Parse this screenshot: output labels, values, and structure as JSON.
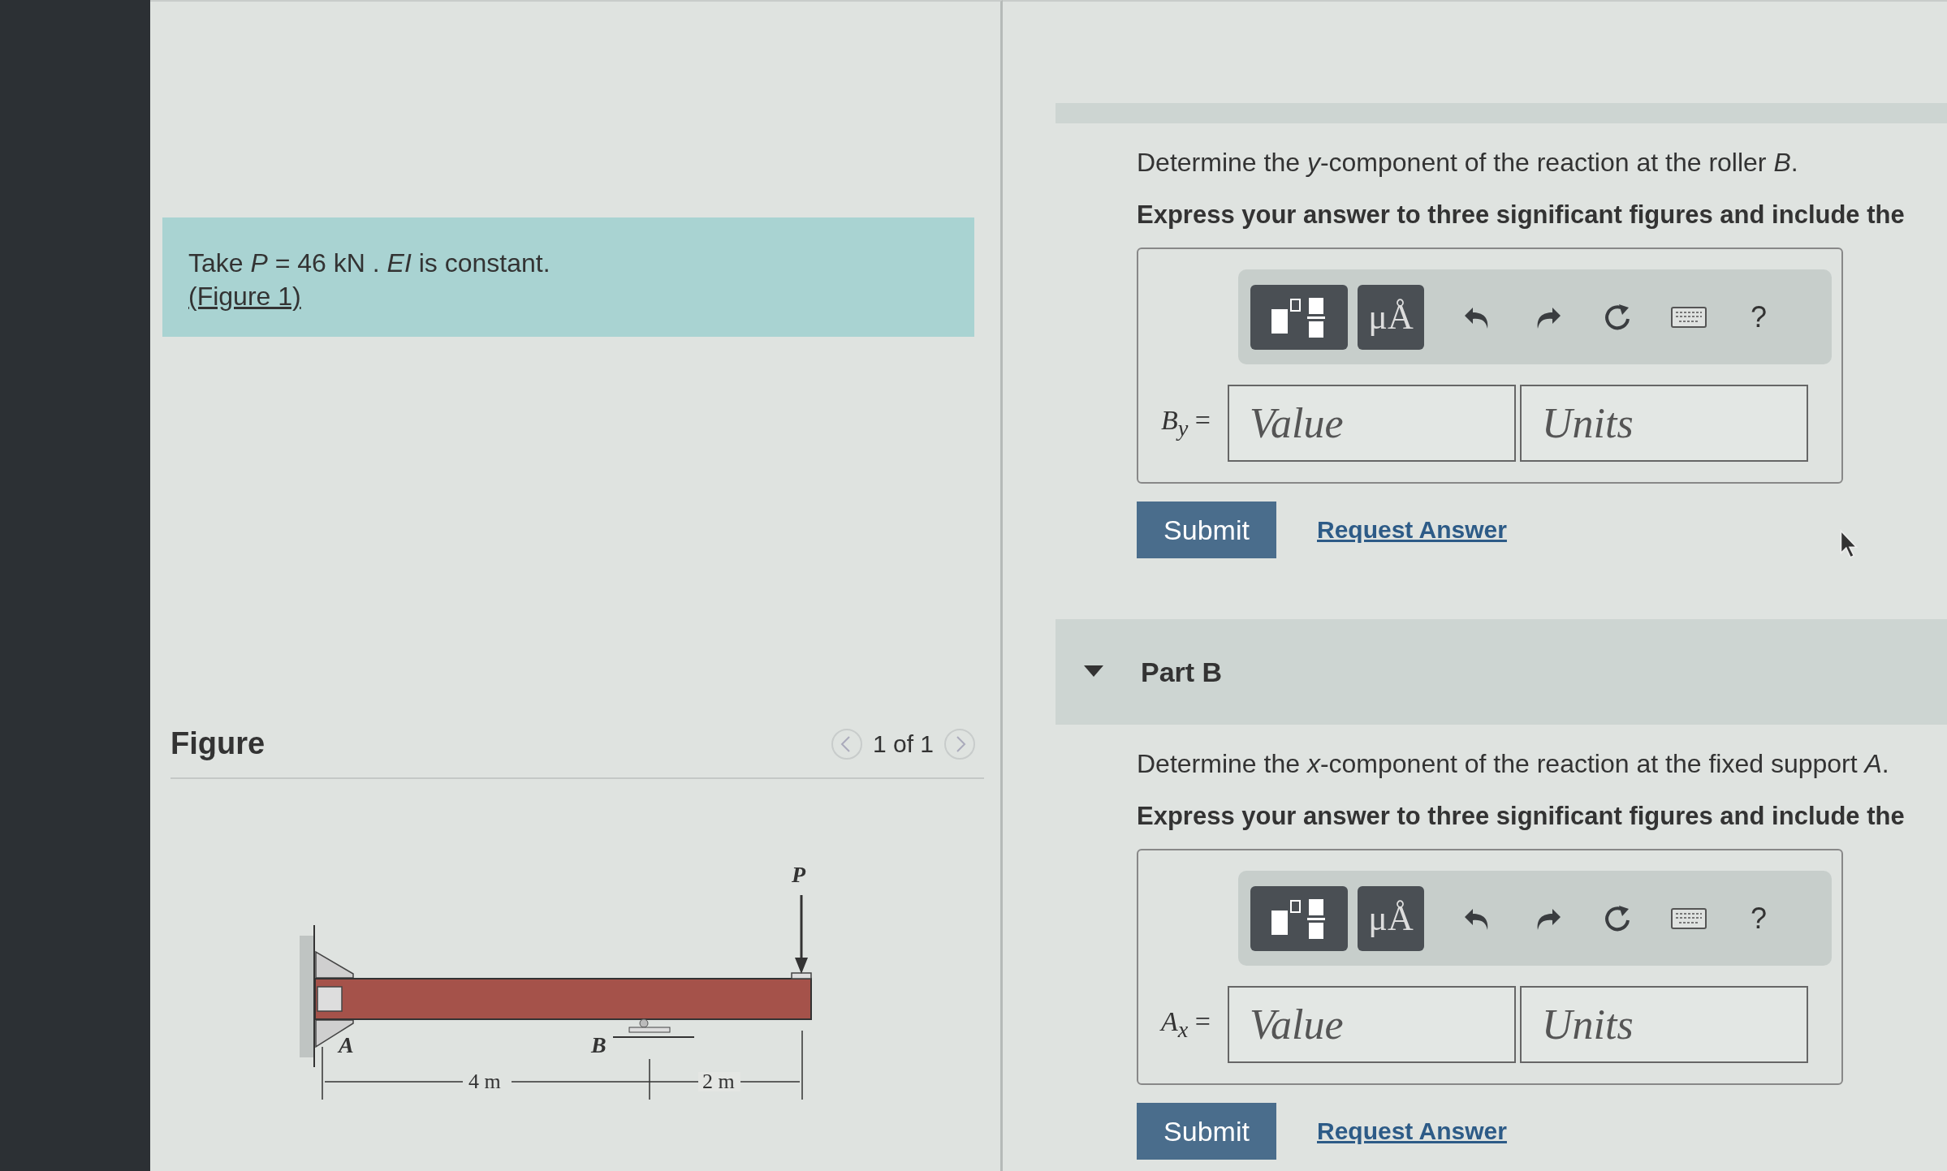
{
  "problem": {
    "text": "Take *P* = 46 kN . *EI* is constant.",
    "link": "(Figure 1)"
  },
  "figure": {
    "title": "Figure",
    "pager": "1 of 1",
    "labels": {
      "load": "P",
      "support_a": "A",
      "support_b": "B",
      "span_1": "4 m",
      "span_2": "2 m"
    }
  },
  "parts": [
    {
      "prompt": "Determine the *y*-component of the reaction at the roller *B*.",
      "instruction": "Express your answer to three significant figures and include the",
      "units_button": "μÅ",
      "help": "?",
      "variable": "*B*$_{y}$ =",
      "value_placeholder": "Value",
      "units_placeholder": "Units",
      "submit": "Submit",
      "request": "Request Answer"
    },
    {
      "title": "Part B",
      "expanded": true,
      "prompt": "Determine the *x*-component of the reaction at the fixed support *A*.",
      "instruction": "Express your answer to three significant figures and include the",
      "units_button": "μÅ",
      "help": "?",
      "variable": "*A*$_{x}$ =",
      "value_placeholder": "Value",
      "units_placeholder": "Units",
      "submit": "Submit",
      "request": "Request Answer"
    }
  ]
}
